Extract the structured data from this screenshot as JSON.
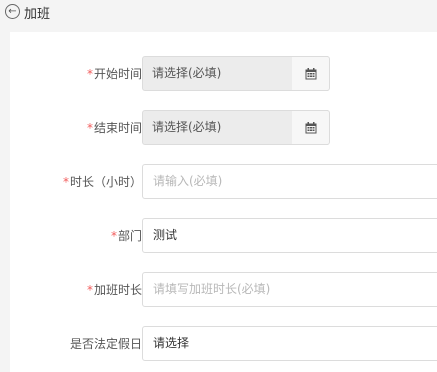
{
  "header": {
    "title": "加班",
    "back_icon": "back-circle-icon"
  },
  "form": {
    "required_mark": "*",
    "start_time": {
      "label": "开始时间",
      "placeholder": "请选择(必填)",
      "icon": "calendar-icon"
    },
    "end_time": {
      "label": "结束时间",
      "placeholder": "请选择(必填)",
      "icon": "calendar-icon"
    },
    "duration": {
      "label": "时长（小时）",
      "placeholder": "请输入(必填)"
    },
    "department": {
      "label": "部门",
      "value": "测试"
    },
    "overtime_duration": {
      "label": "加班时长",
      "placeholder": "请填写加班时长(必填)"
    },
    "holiday": {
      "label": "是否法定假日",
      "value": "请选择"
    }
  },
  "colors": {
    "required": "#f25c5c",
    "placeholder": "#b8b8b8",
    "date_bg": "#ececec"
  }
}
